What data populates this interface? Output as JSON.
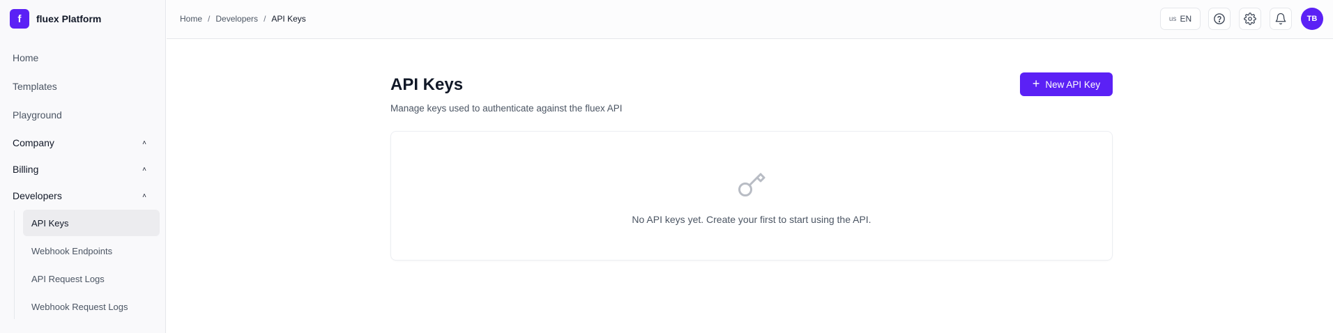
{
  "brand": {
    "logo_letter": "f",
    "name": "fluex Platform"
  },
  "sidebar": {
    "items": [
      {
        "label": "Home"
      },
      {
        "label": "Templates"
      },
      {
        "label": "Playground"
      }
    ],
    "groups": [
      {
        "label": "Company"
      },
      {
        "label": "Billing"
      },
      {
        "label": "Developers"
      }
    ],
    "developers_items": [
      {
        "label": "API Keys",
        "active": true
      },
      {
        "label": "Webhook Endpoints"
      },
      {
        "label": "API Request Logs"
      },
      {
        "label": "Webhook Request Logs"
      }
    ]
  },
  "breadcrumb": [
    "Home",
    "Developers",
    "API Keys"
  ],
  "topbar": {
    "lang_flag": "us",
    "lang_code": "EN",
    "avatar_initials": "TB",
    "icons": [
      "help-icon",
      "gear-icon",
      "bell-icon"
    ]
  },
  "main": {
    "title": "API Keys",
    "subtitle": "Manage keys used to authenticate against the fluex API",
    "new_button_label": "New API Key",
    "empty_message": "No API keys yet. Create your first to start using the API."
  },
  "colors": {
    "accent": "#5b21f5"
  }
}
